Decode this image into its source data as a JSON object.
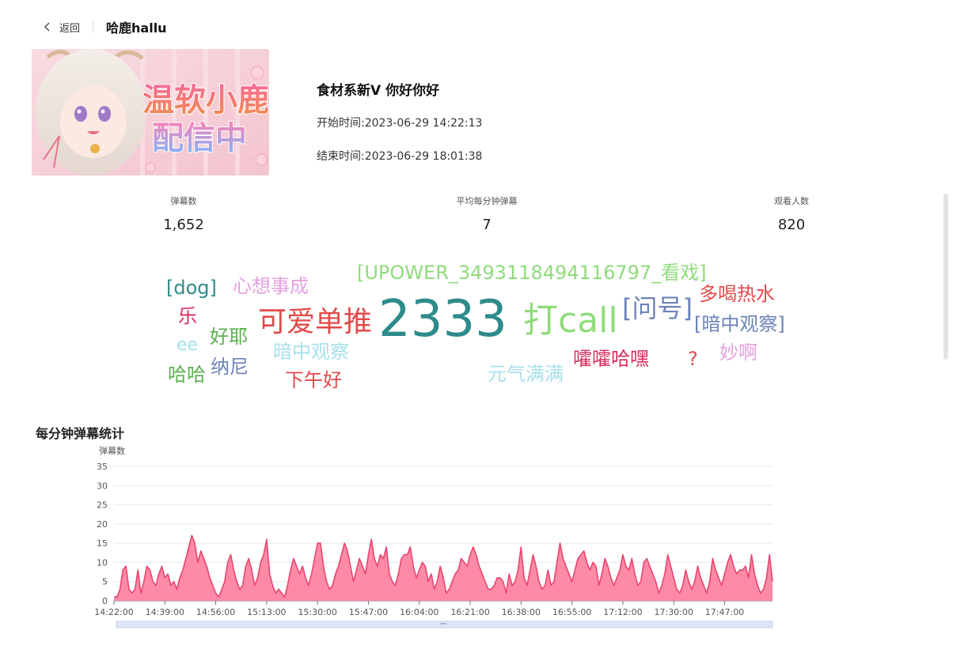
{
  "header": {
    "back_label": "返回",
    "streamer_name": "哈鹿hallu"
  },
  "cover": {
    "line1": "温软小鹿",
    "line2": "配信中"
  },
  "live": {
    "title": "食材系新V 你好你好",
    "start_label": "开始时间:",
    "start_time": "2023-06-29 14:22:13",
    "end_label": "结束时间:",
    "end_time": "2023-06-29 18:01:38"
  },
  "stats": [
    {
      "label": "弹幕数",
      "value": "1,652"
    },
    {
      "label": "平均每分钟弹幕",
      "value": "7"
    },
    {
      "label": "观看人数",
      "value": "820"
    }
  ],
  "word_cloud": [
    {
      "text": "[UPOWER_3493118494116797_看戏]",
      "color": "#8fdc7a"
    },
    {
      "text": "[dog]",
      "color": "#2e8b8b"
    },
    {
      "text": "心想事成",
      "color": "#e6a0e0"
    },
    {
      "text": "多喝热水",
      "color": "#e24a4a"
    },
    {
      "text": "乐",
      "color": "#d62d5a"
    },
    {
      "text": "可爱单推",
      "color": "#e24a4a"
    },
    {
      "text": "2333",
      "color": "#2e8b8b"
    },
    {
      "text": "打call",
      "color": "#8fdc7a"
    },
    {
      "text": "[问号]",
      "color": "#6d84b8"
    },
    {
      "text": "[暗中观察]",
      "color": "#6d84b8"
    },
    {
      "text": "ee",
      "color": "#a8e0ec"
    },
    {
      "text": "好耶",
      "color": "#5ab04e"
    },
    {
      "text": "暗中观察",
      "color": "#a8e0ec"
    },
    {
      "text": "妙啊",
      "color": "#e6a0e0"
    },
    {
      "text": "纳尼",
      "color": "#6d84b8"
    },
    {
      "text": "哈哈",
      "color": "#5ab04e"
    },
    {
      "text": "下午好",
      "color": "#e24a4a"
    },
    {
      "text": "元气满满",
      "color": "#a8e0ec"
    },
    {
      "text": "嚯嚯哈嘿",
      "color": "#d62d5a"
    },
    {
      "text": "?",
      "color": "#e24a4a"
    }
  ],
  "section": {
    "chart_title": "每分钟弹幕统计"
  },
  "chart_data": {
    "type": "area",
    "title": "每分钟弹幕统计",
    "ylabel": "弹幕数",
    "xlabel": "",
    "ylim": [
      0,
      35
    ],
    "yticks": [
      0,
      5,
      10,
      15,
      20,
      25,
      30,
      35
    ],
    "x_tick_labels": [
      "14:22:00",
      "14:39:00",
      "14:56:00",
      "15:13:00",
      "15:30:00",
      "15:47:00",
      "16:04:00",
      "16:21:00",
      "16:38:00",
      "16:55:00",
      "17:12:00",
      "17:30:00",
      "17:47:00"
    ],
    "x_start": "14:22:00",
    "x_end": "18:01:00",
    "interval_minutes": 1,
    "fill_color": "#ff8aa6",
    "line_color": "#e8456f",
    "grid": true,
    "values": [
      1,
      1,
      3,
      8,
      9,
      3,
      2,
      3,
      8,
      2,
      5,
      9,
      8,
      5,
      4,
      7,
      9,
      6,
      7,
      4,
      5,
      3,
      6,
      8,
      11,
      14,
      17,
      15,
      10,
      13,
      11,
      9,
      6,
      4,
      2,
      1,
      3,
      5,
      10,
      12,
      8,
      5,
      3,
      4,
      9,
      11,
      8,
      4,
      6,
      10,
      12,
      16,
      7,
      4,
      2,
      3,
      2,
      1,
      4,
      8,
      11,
      9,
      7,
      9,
      6,
      4,
      7,
      11,
      15,
      15,
      9,
      5,
      3,
      4,
      7,
      9,
      12,
      15,
      13,
      9,
      5,
      8,
      11,
      9,
      7,
      12,
      16,
      11,
      9,
      12,
      11,
      14,
      7,
      5,
      4,
      7,
      11,
      12,
      12,
      14,
      9,
      6,
      8,
      10,
      9,
      5,
      7,
      3,
      5,
      9,
      6,
      2,
      3,
      5,
      7,
      8,
      11,
      10,
      9,
      12,
      14,
      12,
      9,
      7,
      5,
      3,
      3,
      4,
      6,
      6,
      5,
      2,
      7,
      4,
      5,
      8,
      14,
      6,
      4,
      8,
      12,
      9,
      5,
      3,
      4,
      8,
      4,
      5,
      10,
      15,
      11,
      9,
      7,
      5,
      8,
      11,
      12,
      13,
      10,
      8,
      10,
      9,
      4,
      7,
      11,
      9,
      6,
      4,
      6,
      8,
      12,
      9,
      8,
      11,
      7,
      4,
      5,
      10,
      11,
      9,
      7,
      5,
      2,
      4,
      7,
      12,
      9,
      6,
      3,
      2,
      4,
      8,
      5,
      3,
      5,
      9,
      6,
      4,
      2,
      5,
      11,
      8,
      6,
      4,
      7,
      10,
      12,
      9,
      7,
      8,
      8,
      9,
      6,
      12,
      7,
      4,
      2,
      3,
      6,
      12,
      5
    ]
  }
}
